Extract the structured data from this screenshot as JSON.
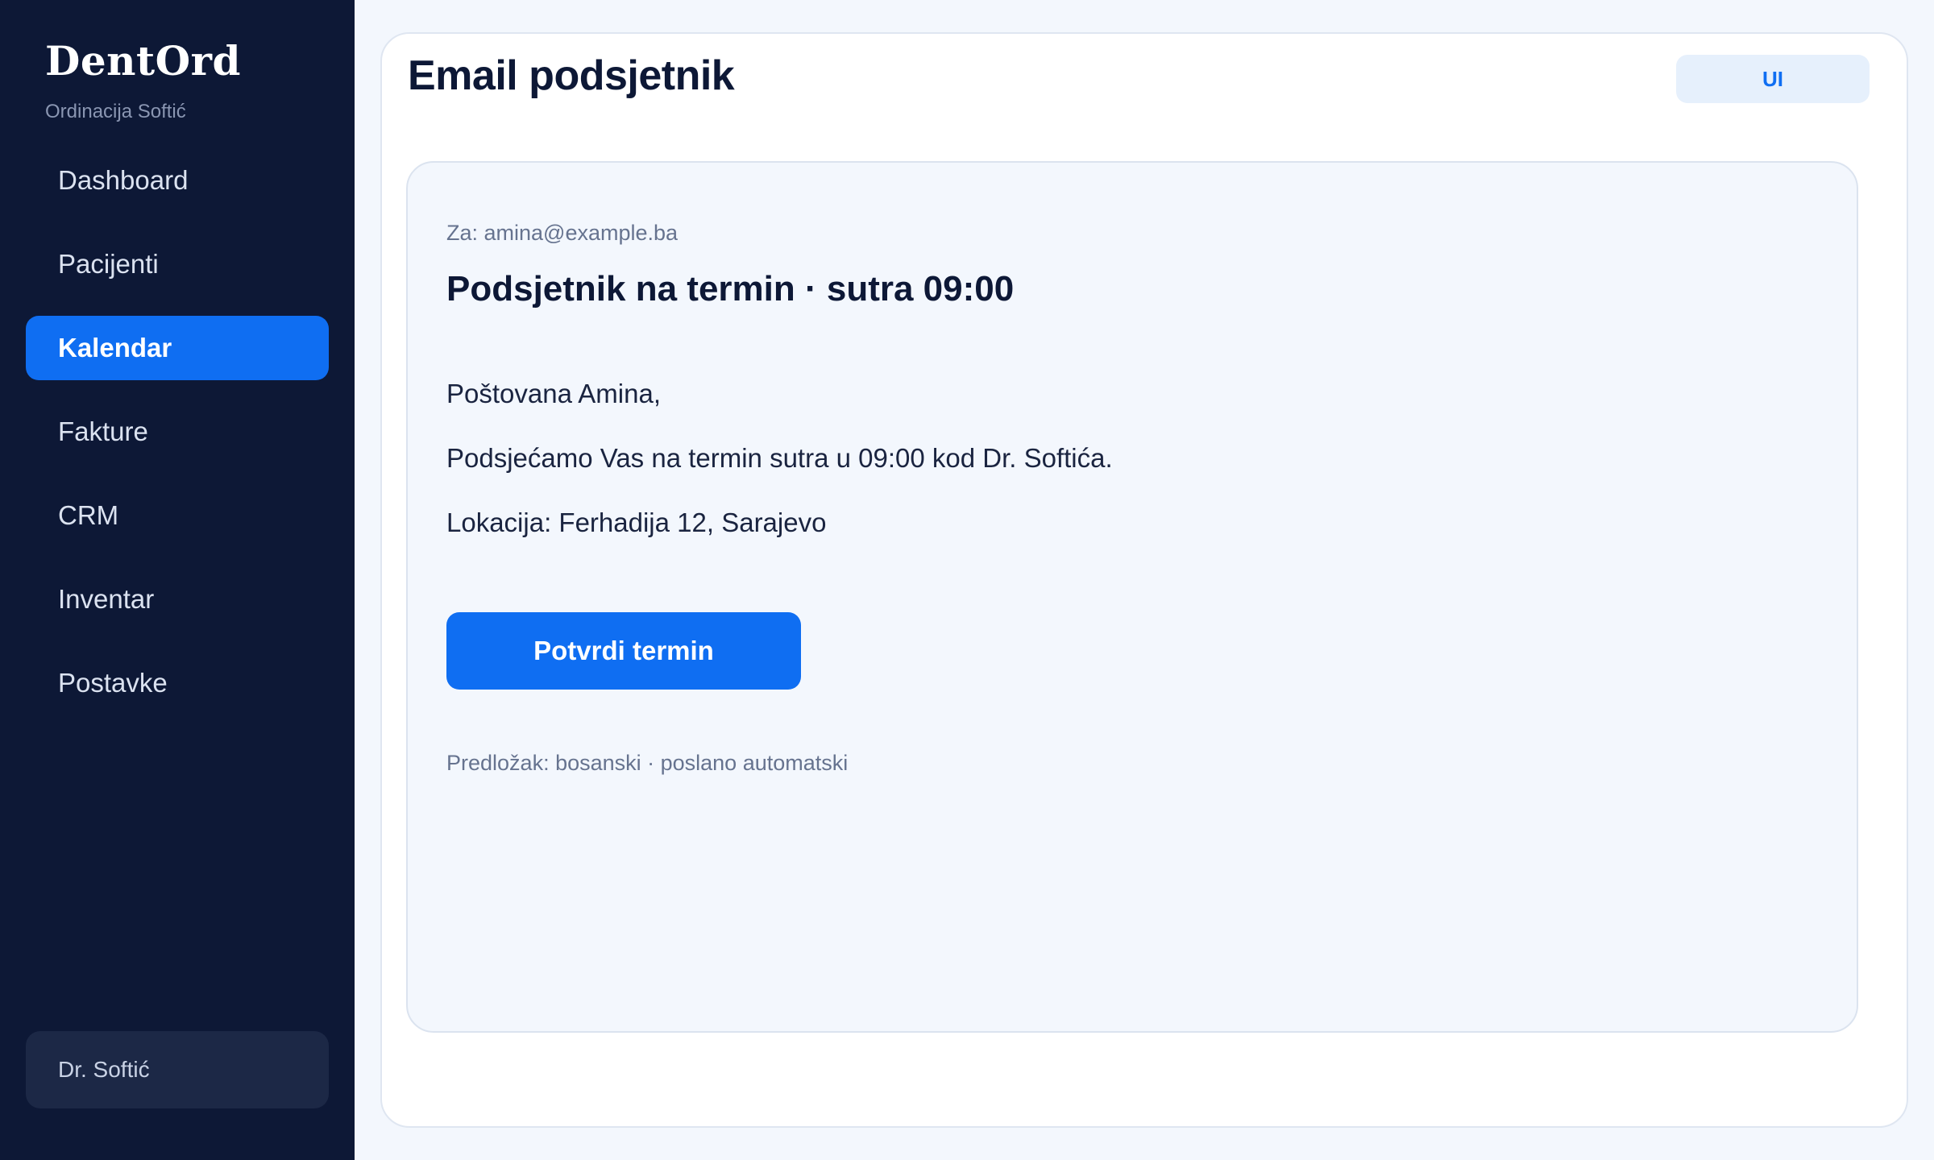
{
  "sidebar": {
    "brand": "DentOrd",
    "subtitle": "Ordinacija Softić",
    "items": [
      {
        "label": "Dashboard",
        "active": false
      },
      {
        "label": "Pacijenti",
        "active": false
      },
      {
        "label": "Kalendar",
        "active": true
      },
      {
        "label": "Fakture",
        "active": false
      },
      {
        "label": "CRM",
        "active": false
      },
      {
        "label": "Inventar",
        "active": false
      },
      {
        "label": "Postavke",
        "active": false
      }
    ],
    "user": "Dr. Softić"
  },
  "main": {
    "title": "Email podsjetnik",
    "badge": "UI",
    "email": {
      "to": "Za: amina@example.ba",
      "subject": "Podsjetnik na termin · sutra 09:00",
      "greeting": "Poštovana Amina,",
      "body": "Podsjećamo Vas na termin sutra u 09:00 kod Dr. Softića.",
      "location": "Lokacija: Ferhadija 12, Sarajevo",
      "button": "Potvrdi termin",
      "footer": "Predložak: bosanski · poslano automatski"
    }
  },
  "colors": {
    "sidebar_bg": "#0d1836",
    "accent": "#0f6ef2",
    "page_bg": "#f3f7fd"
  }
}
